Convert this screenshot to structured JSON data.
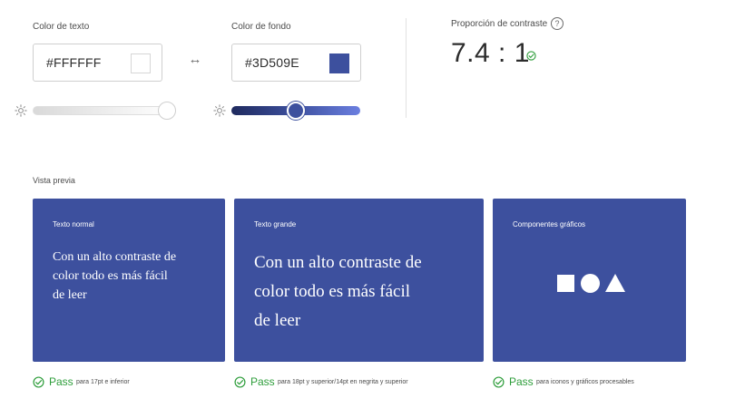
{
  "text_color": {
    "label": "Color de texto",
    "hex": "#FFFFFF",
    "swatch": "#ffffff",
    "slider": {
      "level_percent": 100,
      "track_start": "#d9d9d9",
      "track_end": "#ffffff"
    }
  },
  "background_color": {
    "label": "Color de fondo",
    "hex": "#3D509E",
    "swatch": "#3d509e",
    "slider": {
      "level_percent": 50,
      "track_start": "#1f2a5e",
      "track_end": "#6b7fe0"
    }
  },
  "swap": {
    "icon": "swap-horizontal-icon",
    "glyph": "↔"
  },
  "contrast": {
    "label": "Proporción de contraste",
    "value": "7.4 : 1",
    "help_glyph": "?",
    "status_icon": "check-circle-icon"
  },
  "preview": {
    "label": "Vista previa",
    "cards": [
      {
        "title": "Texto normal",
        "text": "Con un alto contraste de color todo es más fácil de leer",
        "lines": [
          "Con un alto contraste de",
          "color todo es más fácil",
          "de leer"
        ]
      },
      {
        "title": "Texto grande",
        "text": "Con un alto contraste de color todo es más fácil de leer",
        "lines": [
          "Con un alto contraste de",
          "color todo es más fácil",
          "de leer"
        ]
      },
      {
        "title": "Componentes gráficos",
        "shapes": [
          "square",
          "circle",
          "triangle"
        ]
      }
    ],
    "results": [
      {
        "status": "Pass",
        "description": "para 17pt e inferior"
      },
      {
        "status": "Pass",
        "description": "para 18pt y superior/14pt en negrita y superior"
      },
      {
        "status": "Pass",
        "description": "para iconos y gráficos procesables"
      }
    ]
  },
  "colors": {
    "pass_green": "#2d9d3a",
    "card_background": "#3d509e",
    "card_text": "#ffffff"
  }
}
